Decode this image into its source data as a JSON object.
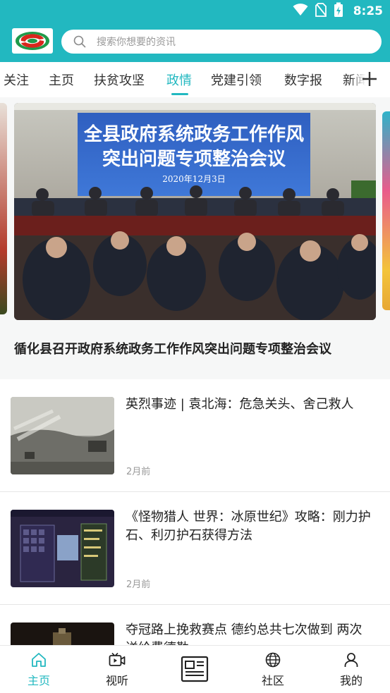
{
  "status_bar": {
    "time": "8:25",
    "icons": [
      "wifi-icon",
      "no-sim-icon",
      "battery-charging-icon"
    ]
  },
  "header": {
    "logo_icon": "app-logo",
    "search": {
      "placeholder": "搜索你想要的资讯",
      "icon": "search-icon"
    }
  },
  "colors": {
    "accent": "#22b8c0",
    "text": "#222222",
    "muted": "#999999"
  },
  "tabs": [
    {
      "label": "关注"
    },
    {
      "label": "主页"
    },
    {
      "label": "扶贫攻坚"
    },
    {
      "label": "政情",
      "active": true
    },
    {
      "label": "党建引领"
    },
    {
      "label": "数字报"
    },
    {
      "label": "新闻"
    }
  ],
  "add_tab_icon": "plus-icon",
  "carousel": {
    "banner_title": "循化县召开政府系统政务工作作风突出问题专项整治会议",
    "image_text": {
      "line1": "全县政府系统政务工作作风",
      "line2": "突出问题专项整治会议",
      "date": "2020年12月3日"
    }
  },
  "news": [
    {
      "title": "英烈事迹 | 袁北海：危急关头、舍己救人",
      "time": "2月前"
    },
    {
      "title": "《怪物猎人 世界：冰原世纪》攻略：刚力护石、利刃护石获得方法",
      "time": "2月前"
    },
    {
      "title": "夺冠路上挽救赛点  德约总共七次做到  两次送给费德勒",
      "time": ""
    }
  ],
  "bottom_nav": [
    {
      "label": "主页",
      "icon": "home-icon",
      "active": true
    },
    {
      "label": "视听",
      "icon": "video-icon"
    },
    {
      "label": "",
      "icon": "newspaper-icon"
    },
    {
      "label": "社区",
      "icon": "globe-icon"
    },
    {
      "label": "我的",
      "icon": "person-icon"
    }
  ]
}
